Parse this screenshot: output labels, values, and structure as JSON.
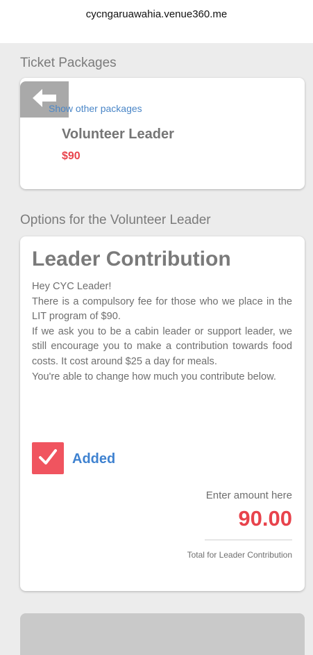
{
  "browser": {
    "url": "cycngaruawahia.venue360.me"
  },
  "ticket_packages": {
    "section_title": "Ticket Packages",
    "show_other_label": "Show other packages",
    "package_name": "Volunteer Leader",
    "package_price": "$90"
  },
  "options": {
    "section_title": "Options for the Volunteer Leader",
    "option_title": "Leader Contribution",
    "description_lines": [
      "Hey CYC Leader!",
      "There is a compulsory fee for those who we place in the LIT program of $90.",
      "If we ask you to be a cabin leader or support leader, we still encourage you to make a contribution towards food costs. It cost around $25 a day for meals.",
      "You're able to change how much you contribute below."
    ],
    "added_label": "Added",
    "added_checked": true,
    "amount_label": "Enter amount here",
    "amount_value": "90.00",
    "amount_caption": "Total for Leader Contribution"
  },
  "icons": {
    "back": "arrow-left-icon",
    "check": "checkmark-icon"
  },
  "colors": {
    "accent_red": "#e8434c",
    "link_blue": "#4a86c7",
    "added_blue": "#3f82d0",
    "checkbox_red": "#f0545f"
  }
}
